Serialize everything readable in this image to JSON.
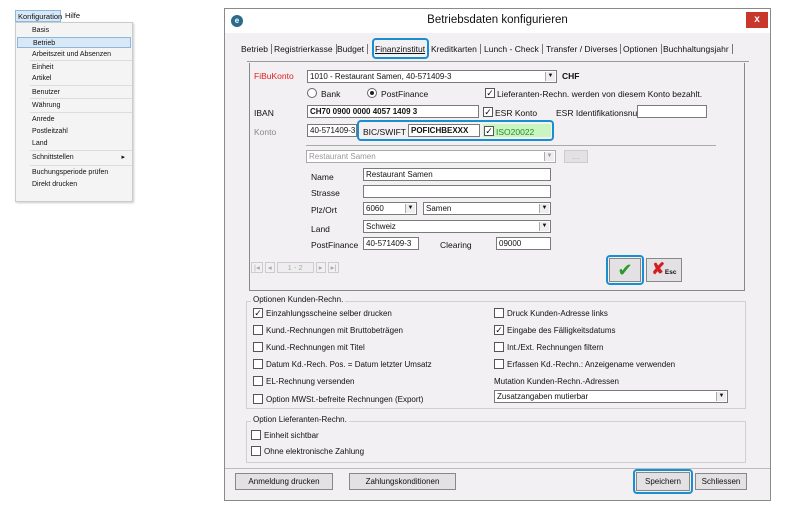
{
  "menubar": {
    "items": [
      "Konfiguration",
      "Hilfe"
    ],
    "dropdown": [
      "Basis",
      "Betrieb",
      "Arbeitszeit und Absenzen",
      "Einheit",
      "Artikel",
      "Benutzer",
      "Währung",
      "Anrede",
      "Postleitzahl",
      "Land",
      "Schnittstellen",
      "Buchungsperiode prüfen",
      "Direkt drucken"
    ],
    "selected": "Betrieb",
    "submenu_arrow": "▸"
  },
  "window": {
    "title": "Betriebsdaten konfigurieren",
    "close": "x",
    "icon": "app-icon"
  },
  "tabs": [
    "Betrieb",
    "Registrierkasse",
    "Budget",
    "Finanzinstitut",
    "Kreditkarten",
    "Lunch - Check",
    "Transfer / Diverses",
    "Optionen",
    "Buchhaltungsjahr"
  ],
  "active_tab": "Finanzinstitut",
  "form": {
    "fibukonto_label": "FiBuKonto",
    "fibukonto_value": "1010 - Restaurant Samen, 40-571409-3",
    "currency": "CHF",
    "radio_bank": "Bank",
    "radio_postfinance": "PostFinance",
    "radio_selected": "PostFinance",
    "lieferanten_label": "Lieferanten-Rechn. werden von diesem Konto bezahlt.",
    "lieferanten_checked": true,
    "iban_label": "IBAN",
    "iban_value": "CH70 0900 0000 4057 1409 3",
    "esr_konto_label": "ESR Konto",
    "esr_konto_checked": true,
    "esr_id_label": "ESR Identifikationsnummer",
    "esr_id_value": "",
    "konto_label": "Konto",
    "konto_value": "40-571409-3",
    "bic_label": "BIC/SWIFT",
    "bic_value": "POFICHBEXXX",
    "iso_label": "ISO20022",
    "iso_checked": true,
    "bank_select": "Restaurant Samen",
    "more_button": "...",
    "name_label": "Name",
    "name_value": "Restaurant Samen",
    "strasse_label": "Strasse",
    "strasse_value": "",
    "plzort_label": "Plz/Ort",
    "plz_value": "6060",
    "ort_value": "Samen",
    "land_label": "Land",
    "land_value": "Schweiz",
    "postfinance_label": "PostFinance",
    "postfinance_value": "40-571409-3",
    "clearing_label": "Clearing",
    "clearing_value": "09000",
    "nav": {
      "first": "|◂",
      "prev": "◂",
      "page": "1 - 2",
      "next": "▸",
      "last": "▸|"
    },
    "ok_icon": "✔",
    "esc_label": "Esc",
    "esc_icon": "✘"
  },
  "kunden": {
    "title": "Optionen Kunden-Rechn.",
    "left": [
      {
        "label": "Einzahlungsscheine selber drucken",
        "checked": true
      },
      {
        "label": "Kund.-Rechnungen mit Bruttobeträgen",
        "checked": false
      },
      {
        "label": "Kund.-Rechnungen mit Titel",
        "checked": false
      },
      {
        "label": "Datum Kd.-Rech. Pos. = Datum letzter Umsatz",
        "checked": false
      },
      {
        "label": "EL-Rechnung versenden",
        "checked": false
      },
      {
        "label": "Option MWSt.-befreite Rechnungen (Export)",
        "checked": false
      }
    ],
    "right": [
      {
        "label": "Druck Kunden-Adresse links",
        "checked": false
      },
      {
        "label": "Eingabe des Fälligkeitsdatums",
        "checked": true
      },
      {
        "label": "Int./Ext. Rechnungen filtern",
        "checked": false
      },
      {
        "label": "Erfassen Kd.-Rechn.: Anzeigename verwenden",
        "checked": false
      }
    ],
    "mutation_label": "Mutation Kunden-Rechn.-Adressen",
    "mutation_value": "Zusatzangaben mutierbar"
  },
  "lieferanten": {
    "title": "Option Lieferanten-Rechn.",
    "items": [
      {
        "label": "Einheit sichtbar",
        "checked": false
      },
      {
        "label": "Ohne elektronische Zahlung",
        "checked": false
      }
    ]
  },
  "buttons": {
    "anmeldung": "Anmeldung drucken",
    "zahlung": "Zahlungskonditionen",
    "speichern": "Speichern",
    "schliessen": "Schliessen"
  },
  "colors": {
    "highlight": "#1a8fd0",
    "required_label": "#e02020",
    "iso_bg": "#c8f5c0",
    "close_bg": "#c9362b"
  }
}
